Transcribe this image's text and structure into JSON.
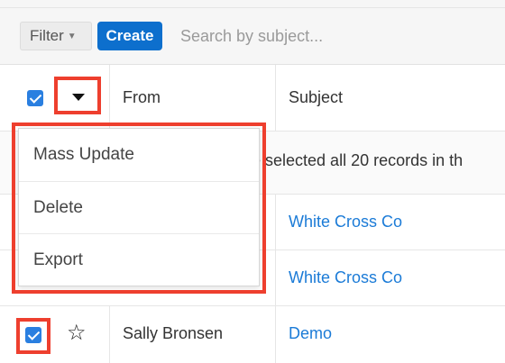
{
  "toolbar": {
    "filter_label": "Filter",
    "create_label": "Create",
    "search_placeholder": "Search by subject..."
  },
  "table": {
    "columns": [
      "From",
      "Subject"
    ],
    "notice_text": "ve selected all 20 records in th",
    "rows": [
      {
        "from": "",
        "subject": "White Cross Co",
        "checked": true
      },
      {
        "from": "",
        "subject": "White Cross Co",
        "checked": true
      },
      {
        "from": "Sally Bronsen",
        "subject": "Demo",
        "checked": true
      }
    ]
  },
  "dropdown": {
    "items": [
      "Mass Update",
      "Delete",
      "Export"
    ]
  },
  "colors": {
    "accent": "#0d6fcd",
    "link": "#1b7bd7",
    "highlight": "#ee3f2e",
    "checkbox": "#2a7fe0"
  },
  "icons": {
    "caret": "chevron-down-icon",
    "favorite": "star-icon",
    "check": "check-icon"
  }
}
